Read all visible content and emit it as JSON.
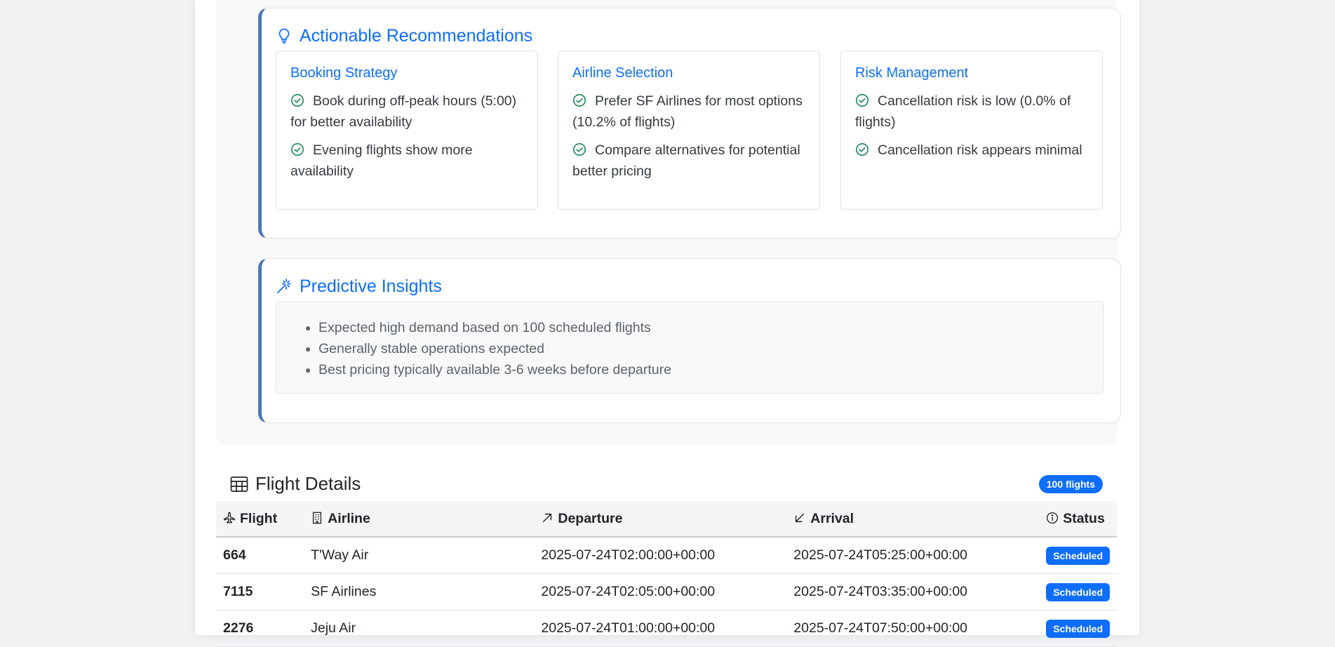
{
  "recommendations": {
    "title": "Actionable Recommendations",
    "sections": [
      {
        "title": "Booking Strategy",
        "items": [
          "Book during off-peak hours (5:00) for better availability",
          "Evening flights show more availability"
        ]
      },
      {
        "title": "Airline Selection",
        "items": [
          "Prefer SF Airlines for most options (10.2% of flights)",
          "Compare alternatives for potential better pricing"
        ]
      },
      {
        "title": "Risk Management",
        "items": [
          "Cancellation risk is low (0.0% of flights)",
          "Cancellation risk appears minimal"
        ]
      }
    ]
  },
  "predictive": {
    "title": "Predictive Insights",
    "items": [
      "Expected high demand based on 100 scheduled flights",
      "Generally stable operations expected",
      "Best pricing typically available 3-6 weeks before departure"
    ]
  },
  "flight_details": {
    "title": "Flight Details",
    "count_badge": "100 flights",
    "columns": [
      "Flight",
      "Airline",
      "Departure",
      "Arrival",
      "Status"
    ],
    "rows": [
      {
        "flight": "664",
        "airline": "T'Way Air",
        "departure": "2025-07-24T02:00:00+00:00",
        "arrival": "2025-07-24T05:25:00+00:00",
        "status": "Scheduled"
      },
      {
        "flight": "7115",
        "airline": "SF Airlines",
        "departure": "2025-07-24T02:05:00+00:00",
        "arrival": "2025-07-24T03:35:00+00:00",
        "status": "Scheduled"
      },
      {
        "flight": "2276",
        "airline": "Jeju Air",
        "departure": "2025-07-24T01:00:00+00:00",
        "arrival": "2025-07-24T07:50:00+00:00",
        "status": "Scheduled"
      }
    ]
  },
  "colors": {
    "accent": "#0d6efd",
    "card_border_left": "#4a77b9",
    "check": "#198754"
  }
}
